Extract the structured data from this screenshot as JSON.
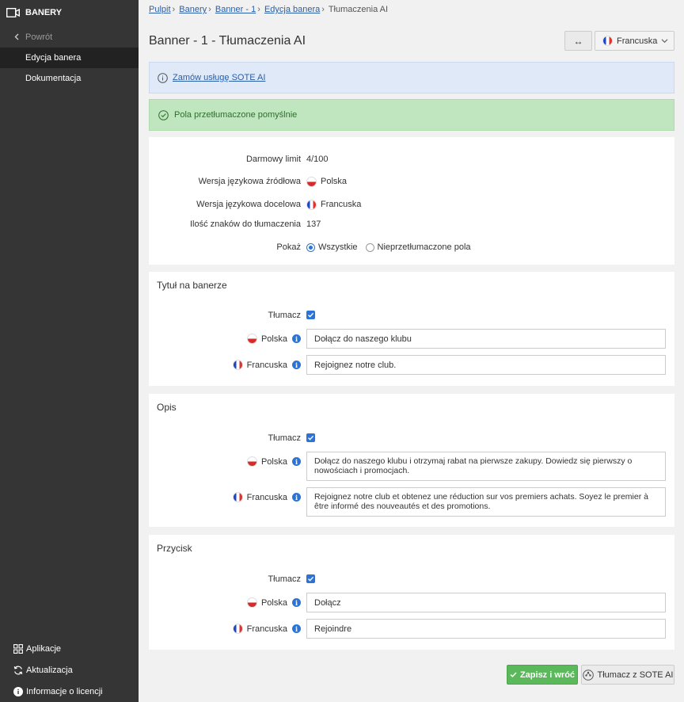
{
  "sidebar": {
    "title": "BANERY",
    "back_label": "Powrót",
    "items": [
      {
        "label": "Edycja banera",
        "active": true
      },
      {
        "label": "Dokumentacja",
        "active": false
      }
    ],
    "bottom": [
      {
        "label": "Aplikacje",
        "icon": "grid-icon"
      },
      {
        "label": "Aktualizacja",
        "icon": "refresh-icon"
      },
      {
        "label": "Informacje o licencji",
        "icon": "info-icon"
      }
    ]
  },
  "breadcrumb": {
    "items": [
      "Pulpit",
      "Banery",
      "Banner - 1",
      "Edycja banera"
    ],
    "current": "Tłumaczenia AI",
    "separator": "›"
  },
  "header": {
    "title": "Banner - 1 - Tłumaczenia AI",
    "swap_label": "↔",
    "language": "Francuska"
  },
  "alerts": {
    "info_link": "Zamów usługę SOTE AI",
    "success": "Pola przetłumaczone pomyślnie"
  },
  "summary": {
    "free_limit_label": "Darmowy limit",
    "free_limit_value": "4/100",
    "source_label": "Wersja językowa źródłowa",
    "source_value": "Polska",
    "target_label": "Wersja językowa docelowa",
    "target_value": "Francuska",
    "chars_label": "Ilość znaków do tłumaczenia",
    "chars_value": "137",
    "show_label": "Pokaż",
    "show_all": "Wszystkie",
    "show_untranslated": "Nieprzetłumaczone pola"
  },
  "sections": {
    "title_field": {
      "heading": "Tytuł na banerze",
      "translator_label": "Tłumacz",
      "pl_label": "Polska",
      "fr_label": "Francuska",
      "pl_value": "Dołącz do naszego klubu",
      "fr_value": "Rejoignez notre club."
    },
    "description": {
      "heading": "Opis",
      "translator_label": "Tłumacz",
      "pl_label": "Polska",
      "fr_label": "Francuska",
      "pl_value": "Dołącz do naszego klubu i otrzymaj rabat na pierwsze zakupy. Dowiedz się pierwszy o nowościach i promocjach.",
      "fr_value": "Rejoignez notre club et obtenez une réduction sur vos premiers achats. Soyez le premier à être informé des nouveautés et des promotions."
    },
    "button": {
      "heading": "Przycisk",
      "translator_label": "Tłumacz",
      "pl_label": "Polska",
      "fr_label": "Francuska",
      "pl_value": "Dołącz",
      "fr_value": "Rejoindre"
    }
  },
  "footer": {
    "save_label": "Zapisz i wróć",
    "ai_label": "Tłumacz z SOTE AI"
  },
  "colors": {
    "sidebar_bg": "#353535",
    "accent_blue": "#2b74d6",
    "success_bg": "#bfe6bf",
    "info_bg": "#dfe9f8",
    "save_green": "#5bb85b"
  }
}
